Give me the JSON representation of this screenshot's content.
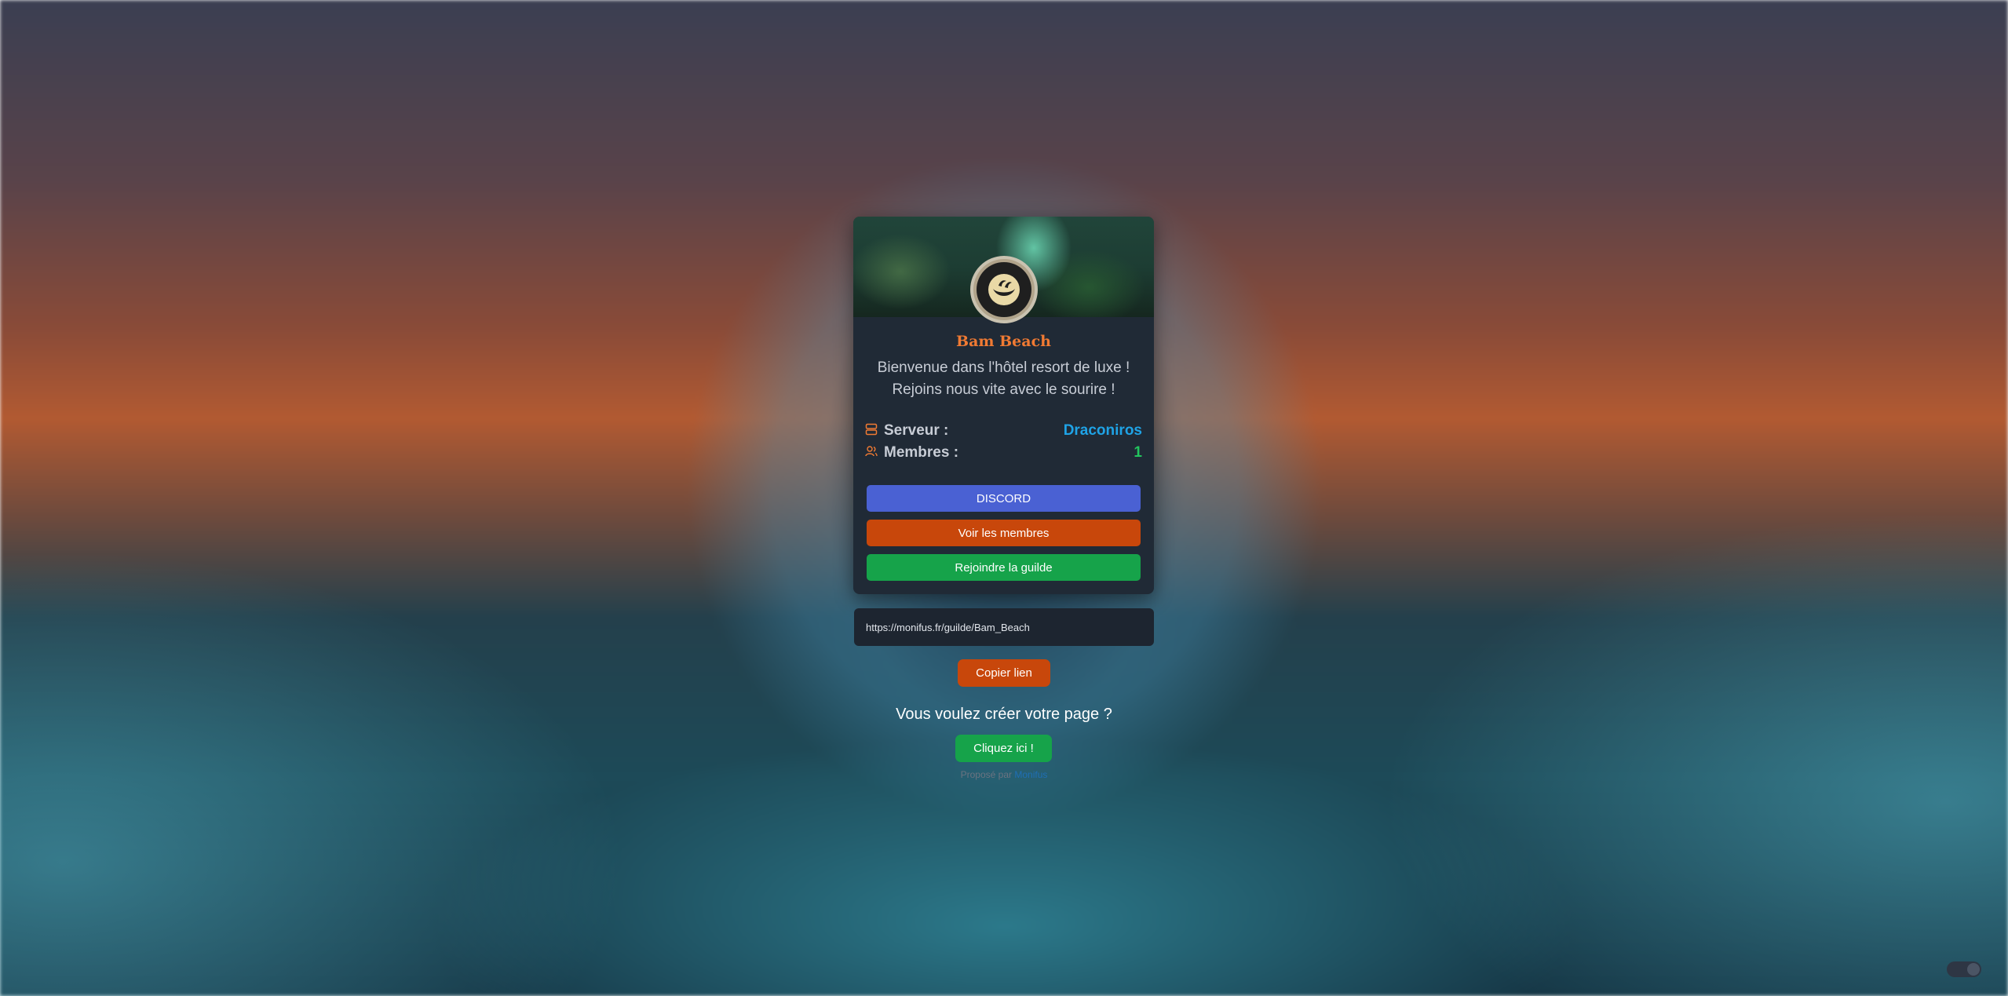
{
  "guild": {
    "name": "Bam Beach",
    "description_line1": "Bienvenue dans l'hôtel resort de luxe !",
    "description_line2": "Rejoins nous vite avec le sourire !",
    "server_label": "Serveur :",
    "server_value": "Draconiros",
    "members_label": "Membres :",
    "members_value": "1"
  },
  "buttons": {
    "discord": "DISCORD",
    "view_members": "Voir les membres",
    "join_guild": "Rejoindre la guilde"
  },
  "share": {
    "url": "https://monifus.fr/guilde/Bam_Beach",
    "copy_label": "Copier lien"
  },
  "cta": {
    "question": "Vous voulez créer votre page ?",
    "button": "Cliquez ici !"
  },
  "footer": {
    "prefix": "Proposé par",
    "link": "Monifus"
  },
  "icons": {
    "server": "server-icon",
    "members": "users-icon"
  },
  "colors": {
    "guild_name": "#f07a33",
    "server_value": "#1fa3e6",
    "members_value": "#22c55e",
    "discord": "#4a61d3",
    "members_button": "#c8470b",
    "join_button": "#16a34a"
  }
}
